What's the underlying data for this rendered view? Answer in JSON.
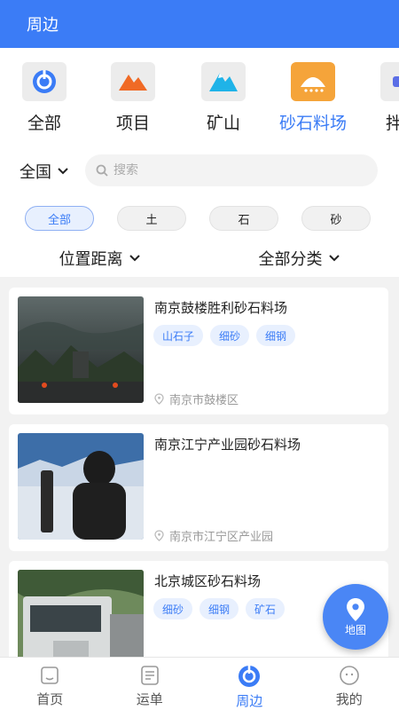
{
  "header": {
    "title": "周边"
  },
  "categories": [
    {
      "label": "全部",
      "icon": "target-icon",
      "active": false
    },
    {
      "label": "项目",
      "icon": "mountain-orange-icon",
      "active": false
    },
    {
      "label": "矿山",
      "icon": "mountain-blue-icon",
      "active": false
    },
    {
      "label": "砂石料场",
      "icon": "sand-pile-icon",
      "active": true
    },
    {
      "label": "拌合",
      "icon": "mixer-icon",
      "active": false
    }
  ],
  "filter": {
    "region": "全国",
    "search_placeholder": "搜索",
    "chips": [
      "全部",
      "土",
      "石",
      "砂"
    ],
    "sort_distance": "位置距离",
    "sort_category": "全部分类"
  },
  "sites": [
    {
      "title": "南京鼓楼胜利砂石料场",
      "tags": [
        "山石子",
        "细砂",
        "细钢"
      ],
      "address": "南京市鼓楼区"
    },
    {
      "title": "南京江宁产业园砂石料场",
      "tags": [],
      "address": "南京市江宁区产业园"
    },
    {
      "title": "北京城区砂石料场",
      "tags": [
        "细砂",
        "细钢",
        "矿石"
      ],
      "address": ""
    }
  ],
  "map_button": {
    "label": "地图"
  },
  "tabbar": [
    {
      "label": "首页",
      "icon": "home-icon"
    },
    {
      "label": "运单",
      "icon": "waybill-icon"
    },
    {
      "label": "周边",
      "icon": "nearby-icon"
    },
    {
      "label": "我的",
      "icon": "profile-icon"
    }
  ],
  "colors": {
    "primary": "#3b7cf6",
    "accent": "#f5a43a"
  }
}
